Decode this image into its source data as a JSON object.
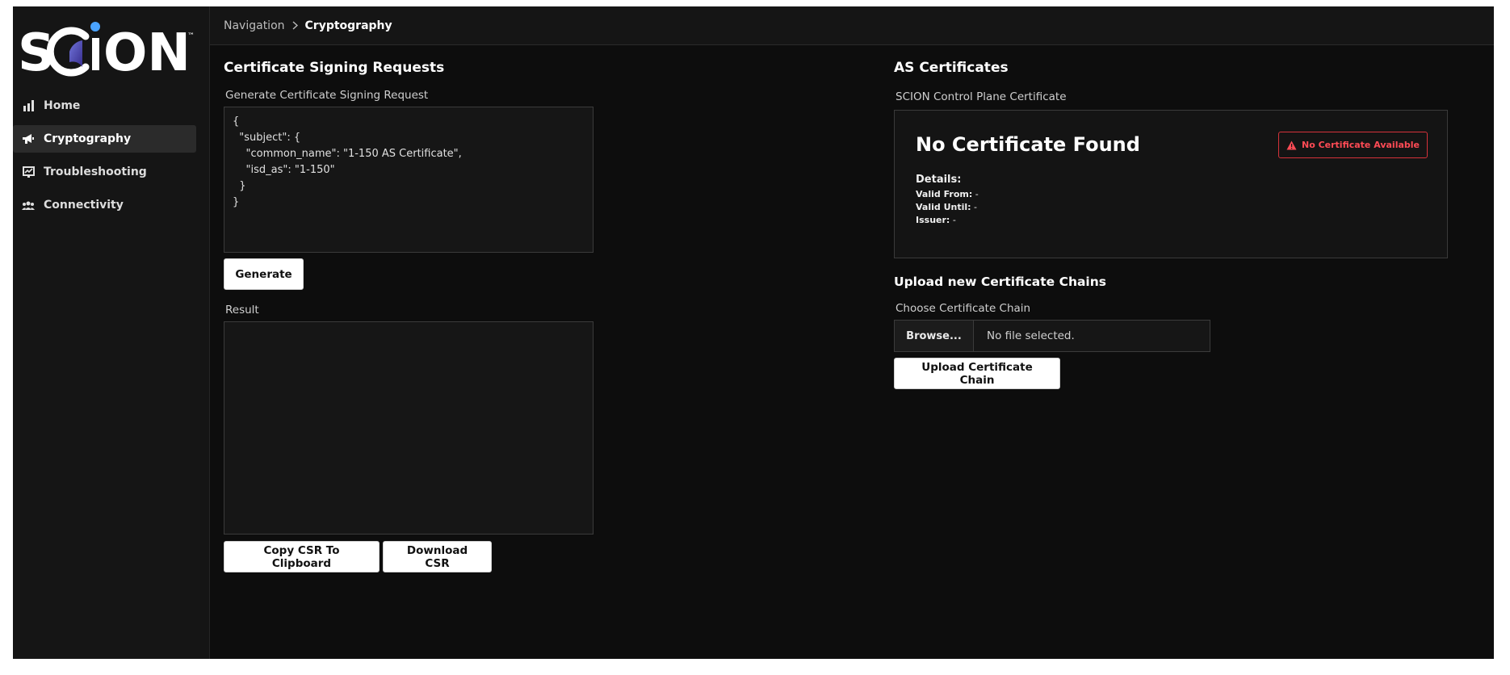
{
  "app": {
    "logo_text": "SCION"
  },
  "sidebar": {
    "items": [
      {
        "label": "Home",
        "icon": "bar-chart-icon",
        "active": false
      },
      {
        "label": "Cryptography",
        "icon": "megaphone-icon",
        "active": true
      },
      {
        "label": "Troubleshooting",
        "icon": "clipboard-chart-icon",
        "active": false
      },
      {
        "label": "Connectivity",
        "icon": "users-icon",
        "active": false
      }
    ]
  },
  "breadcrumb": {
    "root": "Navigation",
    "current": "Cryptography"
  },
  "csr": {
    "title": "Certificate Signing Requests",
    "generate_label": "Generate Certificate Signing Request",
    "request_text": "{\n  \"subject\": {\n    \"common_name\": \"1-150 AS Certificate\",\n    \"isd_as\": \"1-150\"\n  }\n}",
    "generate_button": "Generate",
    "result_label": "Result",
    "result_text": "",
    "copy_button": "Copy CSR To Clipboard",
    "download_button": "Download CSR"
  },
  "as_certs": {
    "title": "AS Certificates",
    "cp_label": "SCION Control Plane Certificate",
    "status_title": "No Certificate Found",
    "badge": "No Certificate Available",
    "details_heading": "Details:",
    "valid_from_label": "Valid From:",
    "valid_from_value": "-",
    "valid_until_label": "Valid Until:",
    "valid_until_value": "-",
    "issuer_label": "Issuer:",
    "issuer_value": "-"
  },
  "upload": {
    "title": "Upload new Certificate Chains",
    "choose_label": "Choose Certificate Chain",
    "browse_button": "Browse...",
    "file_status": "No file selected.",
    "upload_button": "Upload Certificate Chain"
  },
  "colors": {
    "background": "#0d0d0d",
    "sidebar": "#151515",
    "accent_logo": "#5b5fd6",
    "danger": "#ff4b55"
  }
}
